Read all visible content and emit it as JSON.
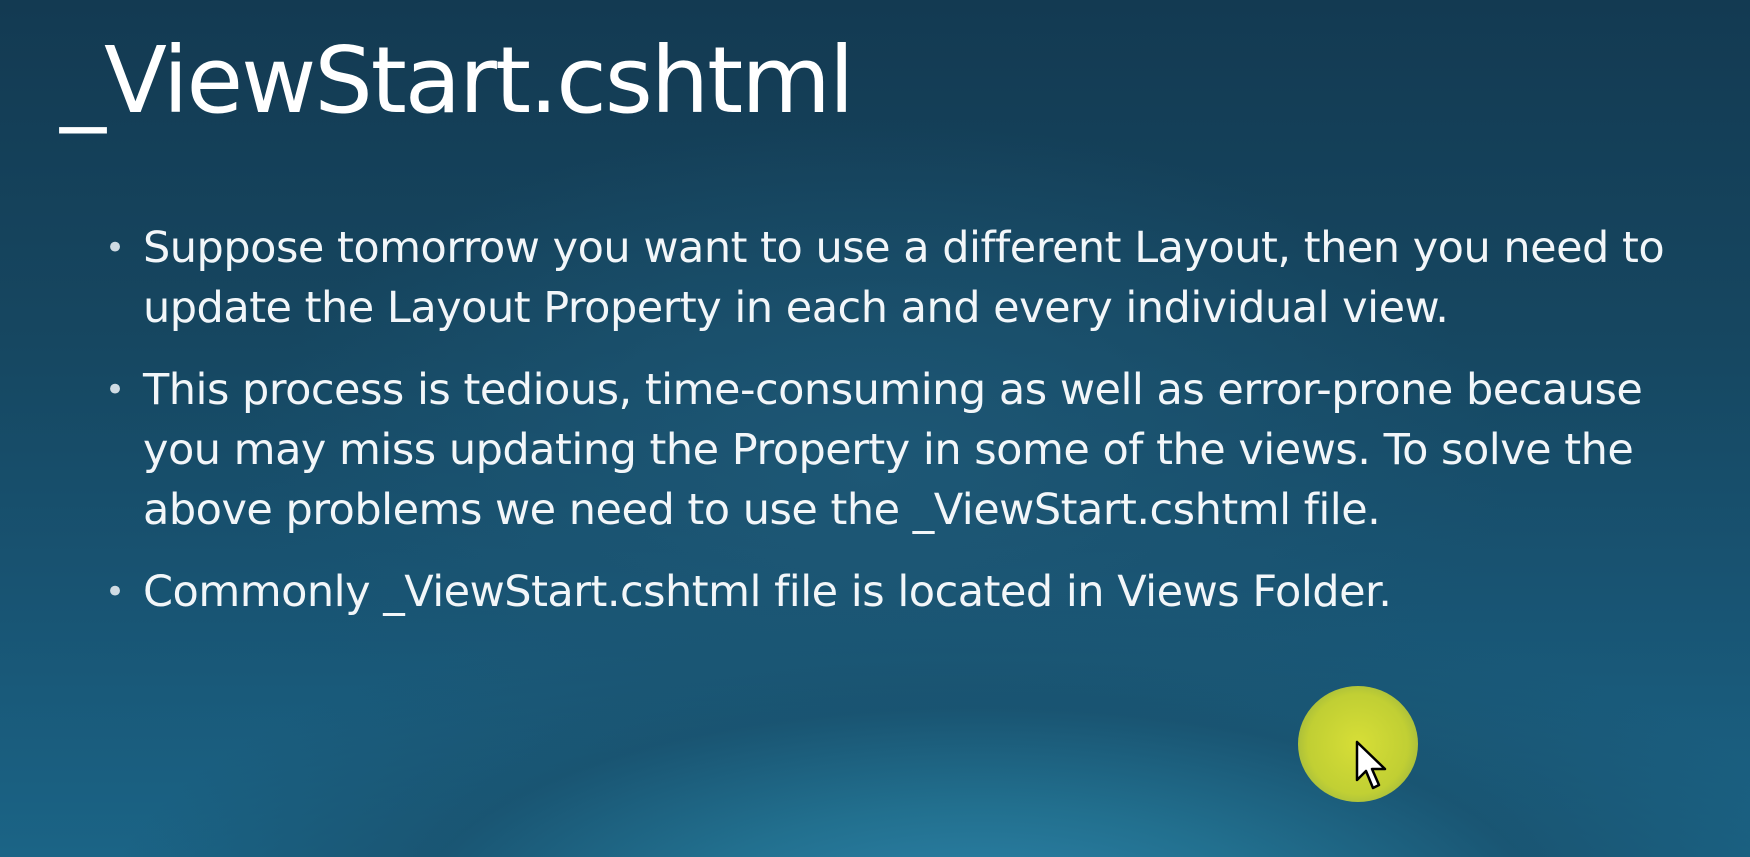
{
  "slide": {
    "title": "_ViewStart.cshtml",
    "bullets": [
      "Suppose tomorrow you want to use a different Layout, then you need to update the Layout Property in each and every individual view.",
      "This process is tedious, time-consuming as well as error-prone because you may miss updating the Property in some of the views. To solve the above problems we need to use the _ViewStart.cshtml file.",
      "Commonly _ViewStart.cshtml file is located in Views Folder."
    ],
    "bullet_glyph": "•"
  },
  "colors": {
    "background_top": "#133a52",
    "background_bottom": "#1b6486",
    "text": "#ffffff",
    "cursor_highlight": "#e7ea32"
  },
  "icons": {
    "pointer": "mouse-pointer-icon",
    "highlight": "cursor-highlight"
  }
}
